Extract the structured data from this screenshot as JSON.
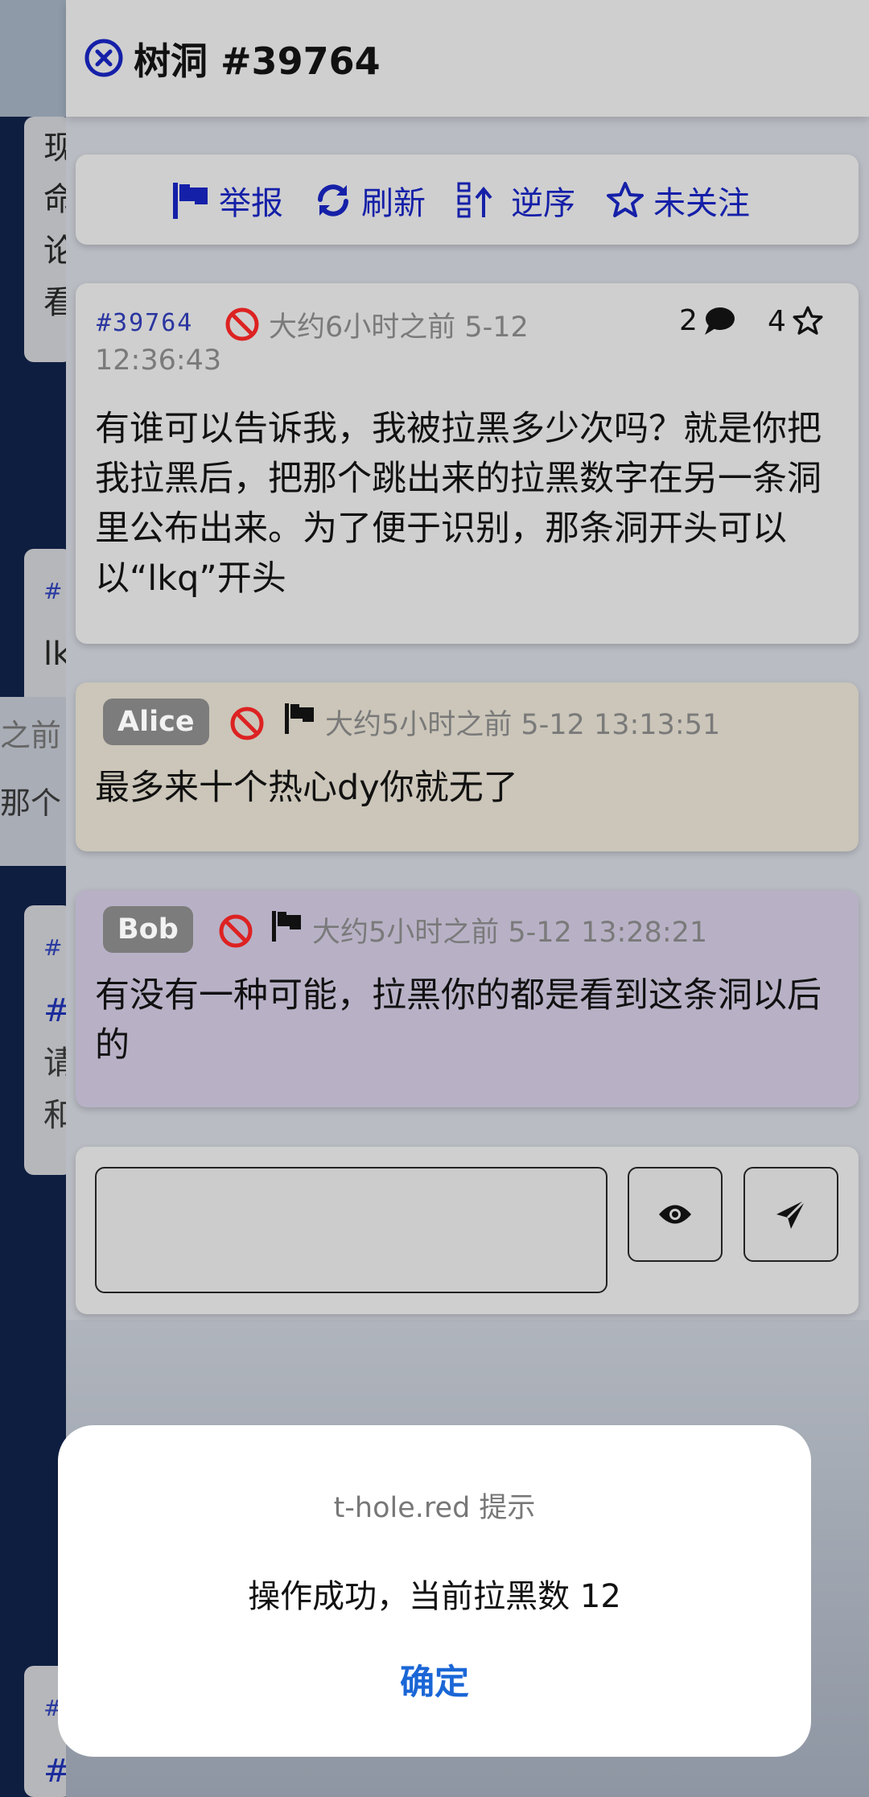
{
  "background": {
    "card1_lines": [
      "现",
      "命",
      "论",
      "看"
    ],
    "card2_hash": "#",
    "card2_text": "lk",
    "side_reply_lines": [
      "之前",
      "那个"
    ],
    "card3_lines": [
      "#",
      "#",
      "请",
      "和"
    ],
    "card4_lines": [
      "#",
      "#"
    ]
  },
  "header": {
    "title": "树洞 #39764",
    "close_icon": "close-circle-icon"
  },
  "toolbar": {
    "report_label": "举报",
    "refresh_label": "刷新",
    "reverse_label": "逆序",
    "follow_label": "未关注"
  },
  "post": {
    "id": "#39764",
    "time_line1": "大约6小时之前 5-12",
    "time_line2": "12:36:43",
    "reply_count": "2",
    "star_count": "4",
    "text": "有谁可以告诉我，我被拉黑多少次吗？就是你把我拉黑后，把那个跳出来的拉黑数字在另一条洞里公布出来。为了便于识别，那条洞开头可以以“lkq”开头"
  },
  "replies": [
    {
      "name": "Alice",
      "time": "大约5小时之前 5-12 13:13:51",
      "text": "最多来十个热心dy你就无了",
      "color": "#cbc6b9"
    },
    {
      "name": "Bob",
      "time": "大约5小时之前 5-12 13:28:21",
      "text": "有没有一种可能，拉黑你的都是看到这条洞以后的",
      "color": "#b8b1c6"
    }
  ],
  "composer": {
    "input_value": "",
    "preview_icon": "eye-icon",
    "send_icon": "send-icon"
  },
  "dialog": {
    "title": "t-hole.red 提示",
    "message": "操作成功，当前拉黑数 12",
    "ok_label": "确定"
  },
  "colors": {
    "accent_blue": "#1520a8",
    "dialog_button": "#1a66d6",
    "background_dark": "#0e1e40"
  }
}
